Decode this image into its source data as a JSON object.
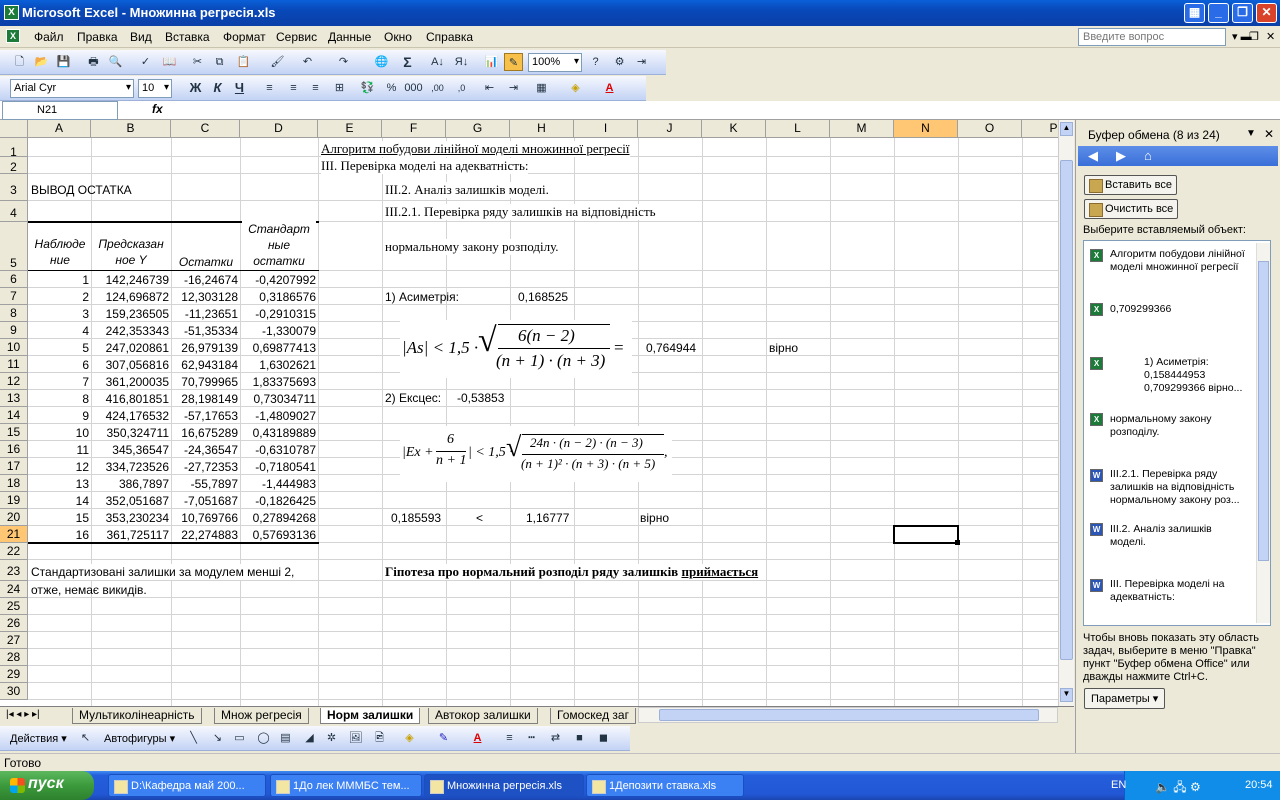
{
  "window": {
    "title": "Microsoft Excel - Множинна регресія.xls",
    "minimize": "_",
    "restore": "❐",
    "close": "✕",
    "app_icon": "excel-icon"
  },
  "menu": {
    "items": [
      "Файл",
      "Правка",
      "Вид",
      "Вставка",
      "Формат",
      "Сервис",
      "Данные",
      "Окно",
      "Справка"
    ],
    "ask": "Введите вопрос"
  },
  "toolbar": {
    "zoom": "100%"
  },
  "formatbar": {
    "font": "Arial Cyr",
    "size": "10",
    "bold": "Ж",
    "italic": "К",
    "underline": "Ч"
  },
  "formula": {
    "cell": "N21",
    "fx": "fx"
  },
  "columns": [
    "A",
    "B",
    "C",
    "D",
    "E",
    "F",
    "G",
    "H",
    "I",
    "J",
    "K",
    "L",
    "M",
    "N",
    "O",
    "P"
  ],
  "rows": [
    "1",
    "2",
    "3",
    "4",
    "5",
    "6",
    "7",
    "8",
    "9",
    "10",
    "11",
    "12",
    "13",
    "14",
    "15",
    "16",
    "17",
    "18",
    "19",
    "20",
    "21",
    "22",
    "23",
    "24",
    "25",
    "26",
    "27",
    "28",
    "29",
    "30"
  ],
  "sheet": {
    "title1": "Алгоритм побудови лінійної моделі множинної регресії",
    "title2": "ІІІ. Перевірка моделі на адекватність:",
    "title3": "ІІІ.2. Аналіз залишків моделі.",
    "title4": "ІІІ.2.1. Перевірка ряду залишків на відповідність",
    "title5": "нормальному закону розподілу.",
    "vyvod": "ВЫВОД ОСТАТКА",
    "hdr_a": "Наблюде ние",
    "hdr_b": "Предсказан ное Y",
    "hdr_c": "Остатки",
    "hdr_d": "Стандарт ные остатки",
    "table": [
      [
        "1",
        "142,246739",
        "-16,24674",
        "-0,4207992"
      ],
      [
        "2",
        "124,696872",
        "12,303128",
        "0,3186576"
      ],
      [
        "3",
        "159,236505",
        "-11,23651",
        "-0,2910315"
      ],
      [
        "4",
        "242,353343",
        "-51,35334",
        "-1,330079"
      ],
      [
        "5",
        "247,020861",
        "26,979139",
        "0,69877413"
      ],
      [
        "6",
        "307,056816",
        "62,943184",
        "1,6302621"
      ],
      [
        "7",
        "361,200035",
        "70,799965",
        "1,83375693"
      ],
      [
        "8",
        "416,801851",
        "28,198149",
        "0,73034711"
      ],
      [
        "9",
        "424,176532",
        "-57,17653",
        "-1,4809027"
      ],
      [
        "10",
        "350,324711",
        "16,675289",
        "0,43189889"
      ],
      [
        "11",
        "345,36547",
        "-24,36547",
        "-0,6310787"
      ],
      [
        "12",
        "334,723526",
        "-27,72353",
        "-0,7180541"
      ],
      [
        "13",
        "386,7897",
        "-55,7897",
        "-1,444983"
      ],
      [
        "14",
        "352,051687",
        "-7,051687",
        "-0,1826425"
      ],
      [
        "15",
        "353,230234",
        "10,769766",
        "0,27894268"
      ],
      [
        "16",
        "361,725117",
        "22,274883",
        "0,57693136"
      ]
    ],
    "asym_label": "1) Асиметрія:",
    "asym_value": "0,168525",
    "asym_result": "0,764944",
    "asym_verdict": "вірно",
    "exc_label": "2) Ексцес:",
    "exc_value": "-0,53853",
    "r20_f": "0,185593",
    "r20_g": "<",
    "r20_h": "1,16777",
    "r20_j": "вірно",
    "note1": "Стандартизовані залишки за модулем менші 2,",
    "note2": "отже, немає викидів.",
    "hypothesis": "Гіпотеза про нормальний розподіл ряду залишків",
    "hypothesis_bold": "приймається"
  },
  "formula1": {
    "lhs": "|As| < 1,5 ·",
    "num": "6(n − 2)",
    "den": "(n + 1) · (n + 3)",
    "eq": "="
  },
  "formula2": {
    "lhs": "|Ex +",
    "frac_num": "6",
    "frac_den": "n + 1",
    "rhs": "| < 1,5 ·",
    "num": "24n · (n − 2) · (n − 3)",
    "den": "(n + 1)² · (n + 3) · (n + 5)",
    "tail": ","
  },
  "tabs": [
    "Мультиколінеарність",
    "Множ регресія",
    "Норм залишки",
    "Автокор залишки",
    "Гомоскед заг"
  ],
  "drawbar": {
    "actions": "Действия ▾",
    "autoshapes": "Автофигуры ▾"
  },
  "status": "Готово",
  "pane": {
    "title": "Буфер обмена (8 из 24)",
    "paste_all": "Вставить все",
    "clear_all": "Очистить все",
    "choose": "Выберите вставляемый объект:",
    "items": [
      "Алгоритм побудови лінійної моделі множинної регресії",
      "0,709299366",
      "1) Асиметрія: 0,158444953 0,709299366 вірно...",
      "нормальному закону розподілу.",
      "ІІІ.2.1. Перевірка ряду залишків на відповідність нормальному закону роз...",
      "ІІІ.2. Аналіз залишків моделі.",
      "ІІІ. Перевірка моделі на адекватність:"
    ],
    "hint": "Чтобы вновь показать эту область задач, выберите в меню \"Правка\" пункт \"Буфер обмена Office\" или дважды нажмите Ctrl+C.",
    "params": "Параметры ▾"
  },
  "taskbar": {
    "start": "пуск",
    "tasks": [
      "D:\\Кафедра май 200...",
      "1До лек МММБС тем...",
      "Множинна регресія.xls",
      "1Депозити ставка.xls"
    ],
    "lang": "EN",
    "clock": "20:54"
  }
}
